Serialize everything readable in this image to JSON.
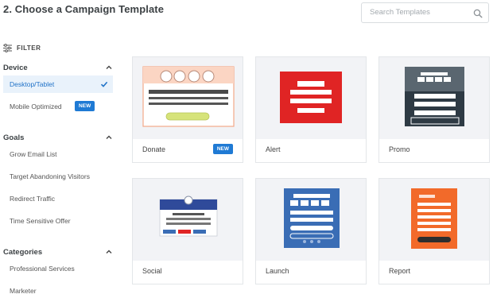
{
  "header": {
    "title": "2. Choose a Campaign Template"
  },
  "search": {
    "placeholder": "Search Templates",
    "icon": "search-icon"
  },
  "filter": {
    "label": "FILTER"
  },
  "sidebar": {
    "device": {
      "heading": "Device",
      "items": [
        {
          "label": "Desktop/Tablet",
          "selected": true
        },
        {
          "label": "Mobile Optimized",
          "badge": "NEW"
        }
      ]
    },
    "goals": {
      "heading": "Goals",
      "items": [
        {
          "label": "Grow Email List"
        },
        {
          "label": "Target Abandoning Visitors"
        },
        {
          "label": "Redirect Traffic"
        },
        {
          "label": "Time Sensitive Offer"
        }
      ]
    },
    "categories": {
      "heading": "Categories",
      "items": [
        {
          "label": "Professional Services"
        },
        {
          "label": "Marketer"
        }
      ]
    }
  },
  "templates": [
    {
      "name": "Donate",
      "badge": "NEW",
      "accent": "#f6b99a"
    },
    {
      "name": "Alert",
      "accent": "#e02424"
    },
    {
      "name": "Promo",
      "accent": "#2e3a44"
    },
    {
      "name": "Social",
      "accent": "#2f4a9a"
    },
    {
      "name": "Launch",
      "accent": "#3a6db5"
    },
    {
      "name": "Report",
      "accent": "#f26a2a"
    }
  ],
  "colors": {
    "accent_blue": "#1f7ad4",
    "selected_bg": "#e9f2fb"
  }
}
